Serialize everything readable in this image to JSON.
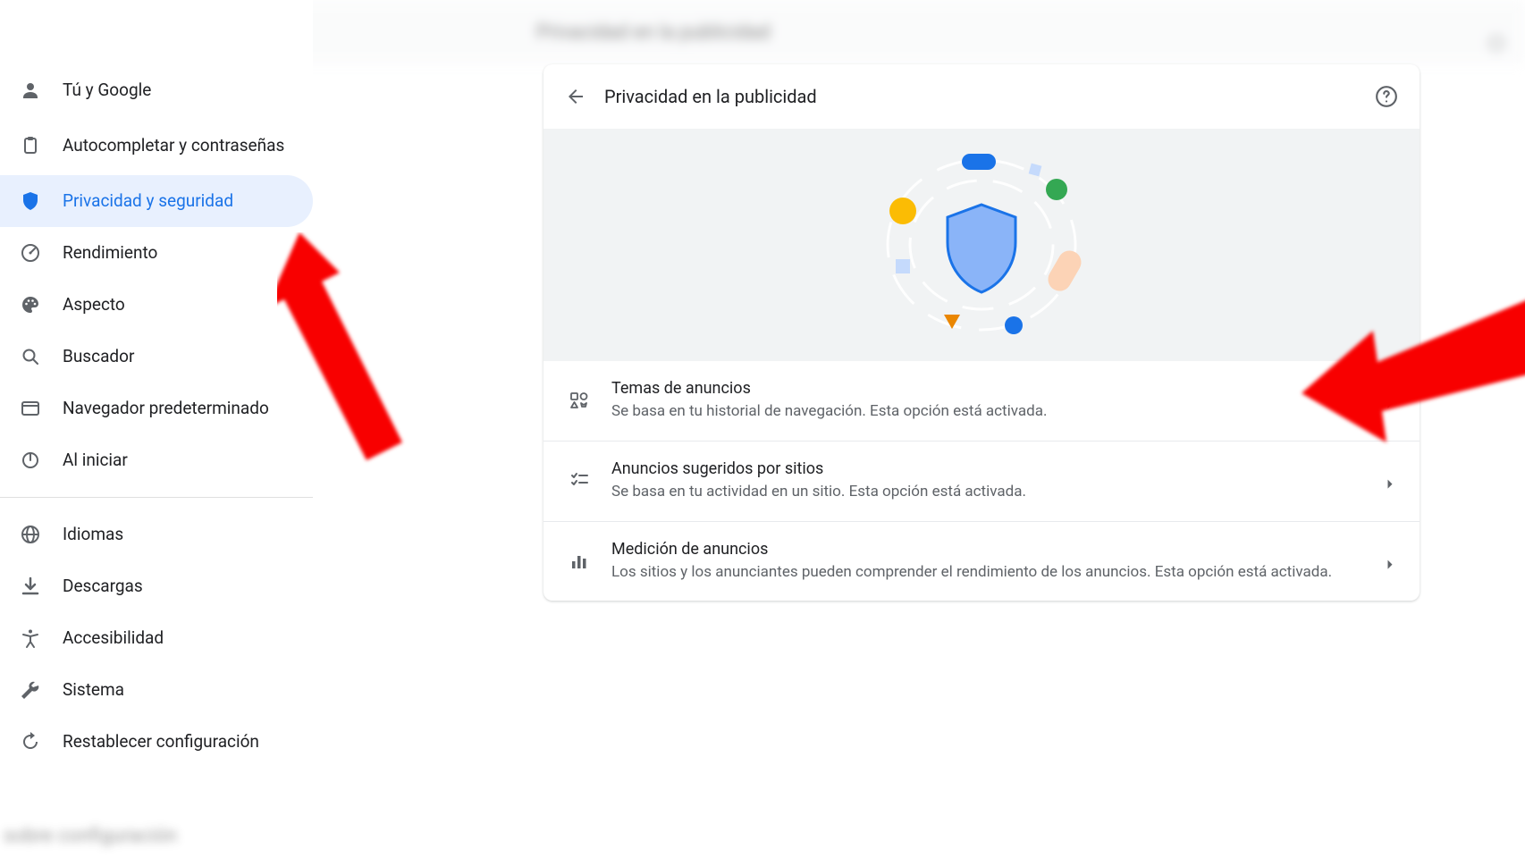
{
  "sidebar": {
    "items_top": [
      {
        "key": "you-google",
        "icon": "person",
        "label": "Tú y Google"
      },
      {
        "key": "autofill",
        "icon": "clipboard",
        "label": "Autocompletar y contraseñas",
        "multiline": true
      },
      {
        "key": "privacy",
        "icon": "shield",
        "label": "Privacidad y seguridad",
        "active": true
      },
      {
        "key": "performance",
        "icon": "speed",
        "label": "Rendimiento"
      },
      {
        "key": "appearance",
        "icon": "palette",
        "label": "Aspecto"
      },
      {
        "key": "search",
        "icon": "search",
        "label": "Buscador"
      },
      {
        "key": "default-browser",
        "icon": "browser",
        "label": "Navegador predeterminado"
      },
      {
        "key": "startup",
        "icon": "power",
        "label": "Al iniciar"
      }
    ],
    "items_bottom": [
      {
        "key": "languages",
        "icon": "globe",
        "label": "Idiomas"
      },
      {
        "key": "downloads",
        "icon": "download",
        "label": "Descargas"
      },
      {
        "key": "accessibility",
        "icon": "accessibility",
        "label": "Accesibilidad"
      },
      {
        "key": "system",
        "icon": "wrench",
        "label": "Sistema"
      },
      {
        "key": "reset",
        "icon": "restore",
        "label": "Restablecer configuración"
      }
    ]
  },
  "panel": {
    "title": "Privacidad en la publicidad",
    "rows": [
      {
        "icon": "topics",
        "title": "Temas de anuncios",
        "sub": "Se basa en tu historial de navegación. Esta opción está activada."
      },
      {
        "icon": "checklist",
        "title": "Anuncios sugeridos por sitios",
        "sub": "Se basa en tu actividad en un sitio. Esta opción está activada."
      },
      {
        "icon": "barchart",
        "title": "Medición de anuncios",
        "sub": "Los sitios y los anunciantes pueden comprender el rendimiento de los anuncios. Esta opción está activada."
      }
    ]
  }
}
